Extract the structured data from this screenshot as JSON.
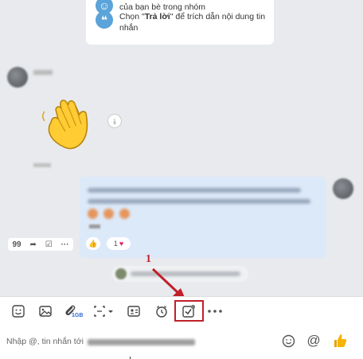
{
  "tips": [
    {
      "icon": "group-icon",
      "text": "của bạn bè trong nhóm"
    },
    {
      "icon": "quote-icon",
      "text_prefix": "Chọn \"",
      "text_bold": "Trả lời",
      "text_suffix": "\" để trích dẫn nội dung tin nhắn"
    }
  ],
  "conversation": {
    "incoming_message": {
      "sticker": "waving-hand-sticker"
    },
    "outgoing_message": {
      "reaction_count": "1"
    },
    "action_bar": {
      "quote_label": "99"
    }
  },
  "annotation": {
    "step_number": "1",
    "color": "#c0202a"
  },
  "toolbar": {
    "items": [
      "sticker-icon",
      "image-icon",
      "attach-file-icon",
      "screenshot-icon",
      "contact-card-icon",
      "reminder-icon",
      "assign-task-icon",
      "more-icon"
    ],
    "file_size_badge": "1GB"
  },
  "composer": {
    "placeholder": "Nhập @, tin nhắn tới",
    "accent": "#f5b400"
  }
}
